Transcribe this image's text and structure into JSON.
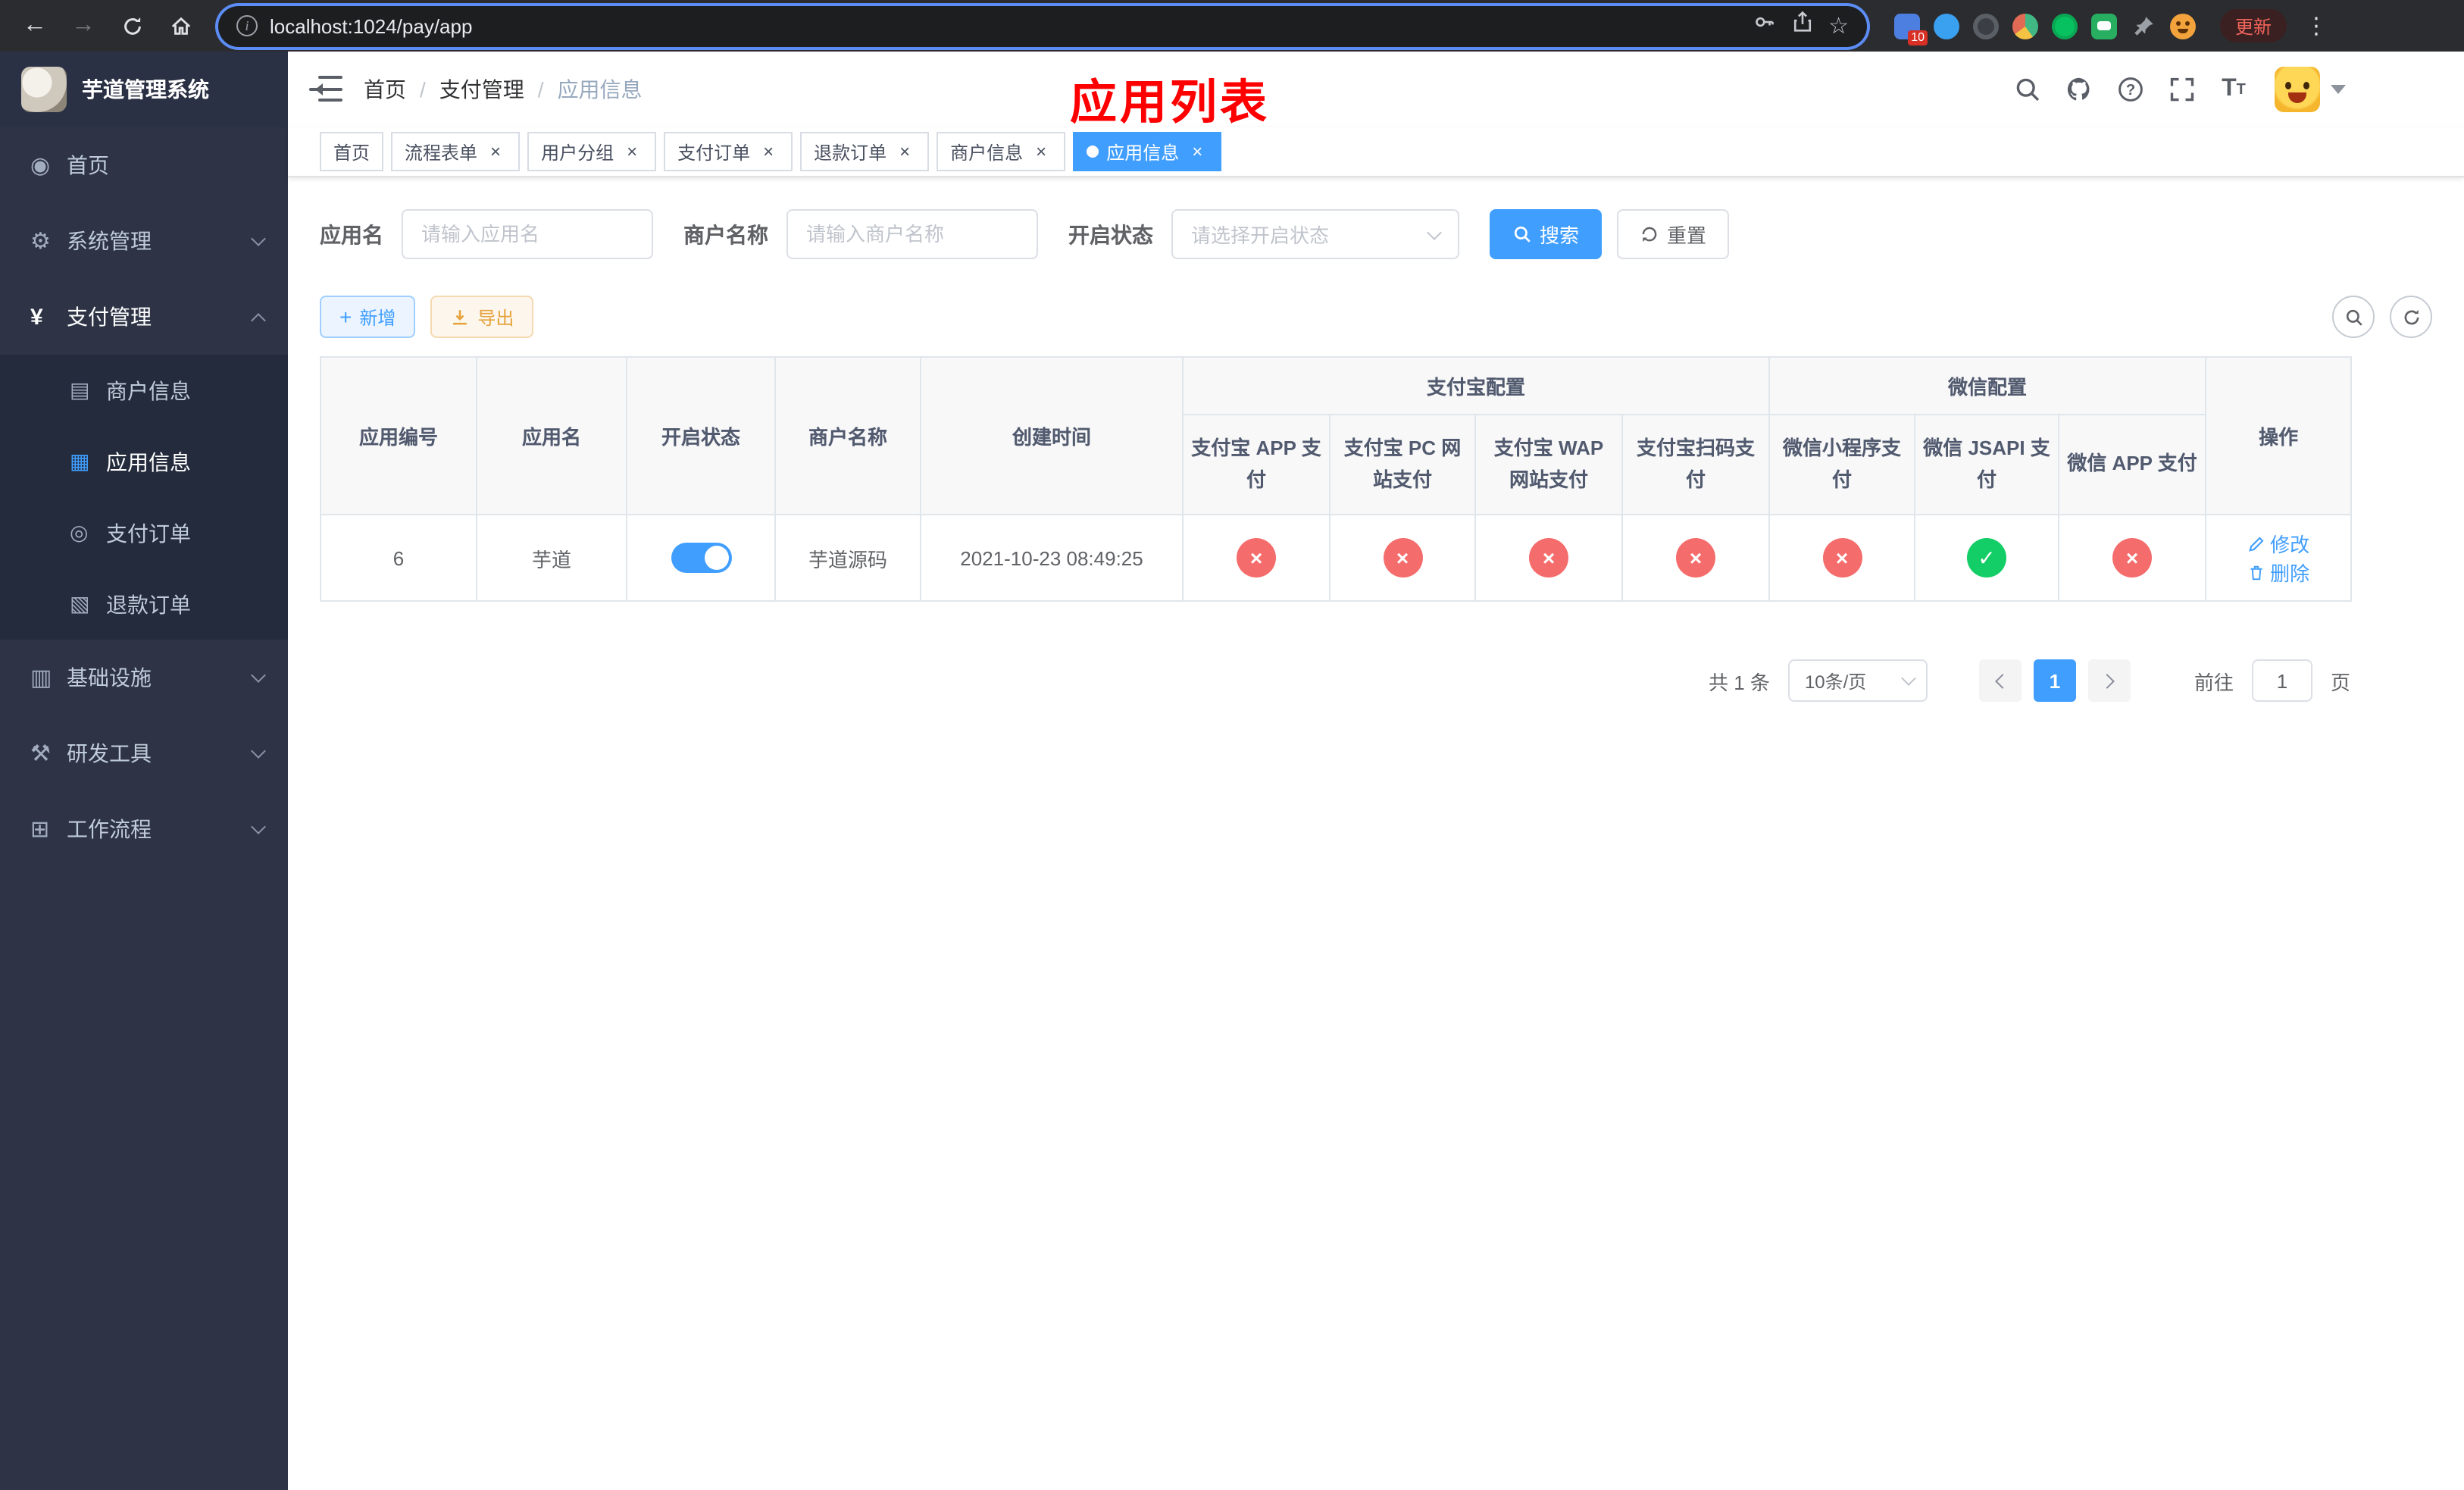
{
  "browser": {
    "url": "localhost:1024/pay/app",
    "update_label": "更新",
    "extension_badge": "10"
  },
  "icons": {
    "back": "←",
    "forward": "→",
    "info": "i",
    "star": "☆",
    "kebab": "⋮",
    "menu_home": "◉",
    "menu_system": "⚙",
    "menu_pay": "¥",
    "menu_merchant": "▤",
    "menu_app": "▦",
    "menu_order": "◎",
    "menu_refund": "▧",
    "menu_infra": "▥",
    "menu_devtool": "⚒",
    "menu_workflow": "⊞",
    "plus": "+"
  },
  "colors": {
    "accent": "#409EFF",
    "success": "#13ce66",
    "danger": "#f56c6c",
    "warning": "#e6a23c",
    "annotation_red": "#fe0000"
  },
  "annotation": {
    "title": "应用列表"
  },
  "sidebar": {
    "app_title": "芋道管理系统",
    "menu": [
      {
        "label": "首页"
      },
      {
        "label": "系统管理"
      },
      {
        "label": "支付管理"
      },
      {
        "label": "基础设施"
      },
      {
        "label": "研发工具"
      },
      {
        "label": "工作流程"
      }
    ],
    "submenu": [
      {
        "label": "商户信息"
      },
      {
        "label": "应用信息"
      },
      {
        "label": "支付订单"
      },
      {
        "label": "退款订单"
      }
    ]
  },
  "breadcrumb": {
    "items": [
      "首页",
      "支付管理",
      "应用信息"
    ],
    "separator": "/"
  },
  "tabs": [
    {
      "label": "首页"
    },
    {
      "label": "流程表单"
    },
    {
      "label": "用户分组"
    },
    {
      "label": "支付订单"
    },
    {
      "label": "退款订单"
    },
    {
      "label": "商户信息"
    },
    {
      "label": "应用信息"
    }
  ],
  "filters": {
    "app_name_label": "应用名",
    "app_name_placeholder": "请输入应用名",
    "merchant_label": "商户名称",
    "merchant_placeholder": "请输入商户名称",
    "status_label": "开启状态",
    "status_placeholder": "请选择开启状态",
    "search_label": "搜索",
    "reset_label": "重置"
  },
  "toolbar": {
    "add_label": "新增",
    "export_label": "导出"
  },
  "table": {
    "columns": [
      "应用编号",
      "应用名",
      "开启状态",
      "商户名称",
      "创建时间"
    ],
    "group_alipay": "支付宝配置",
    "group_wechat": "微信配置",
    "alipay_cols": [
      "支付宝 APP 支付",
      "支付宝 PC 网站支付",
      "支付宝 WAP 网站支付",
      "支付宝扫码支付"
    ],
    "wechat_cols": [
      "微信小程序支付",
      "微信 JSAPI 支付",
      "微信 APP 支付"
    ],
    "op_col": "操作",
    "row": {
      "id": "6",
      "name": "芋道",
      "status_on": true,
      "merchant": "芋道源码",
      "created": "2021-10-23 08:49:25",
      "config_states": [
        false,
        false,
        false,
        false,
        false,
        true,
        false
      ],
      "edit_label": "修改",
      "delete_label": "删除"
    }
  },
  "pagination": {
    "total": "共 1 条",
    "size": "10条/页",
    "page": "1",
    "goto_label": "前往",
    "goto_value": "1",
    "unit_label": "页"
  }
}
